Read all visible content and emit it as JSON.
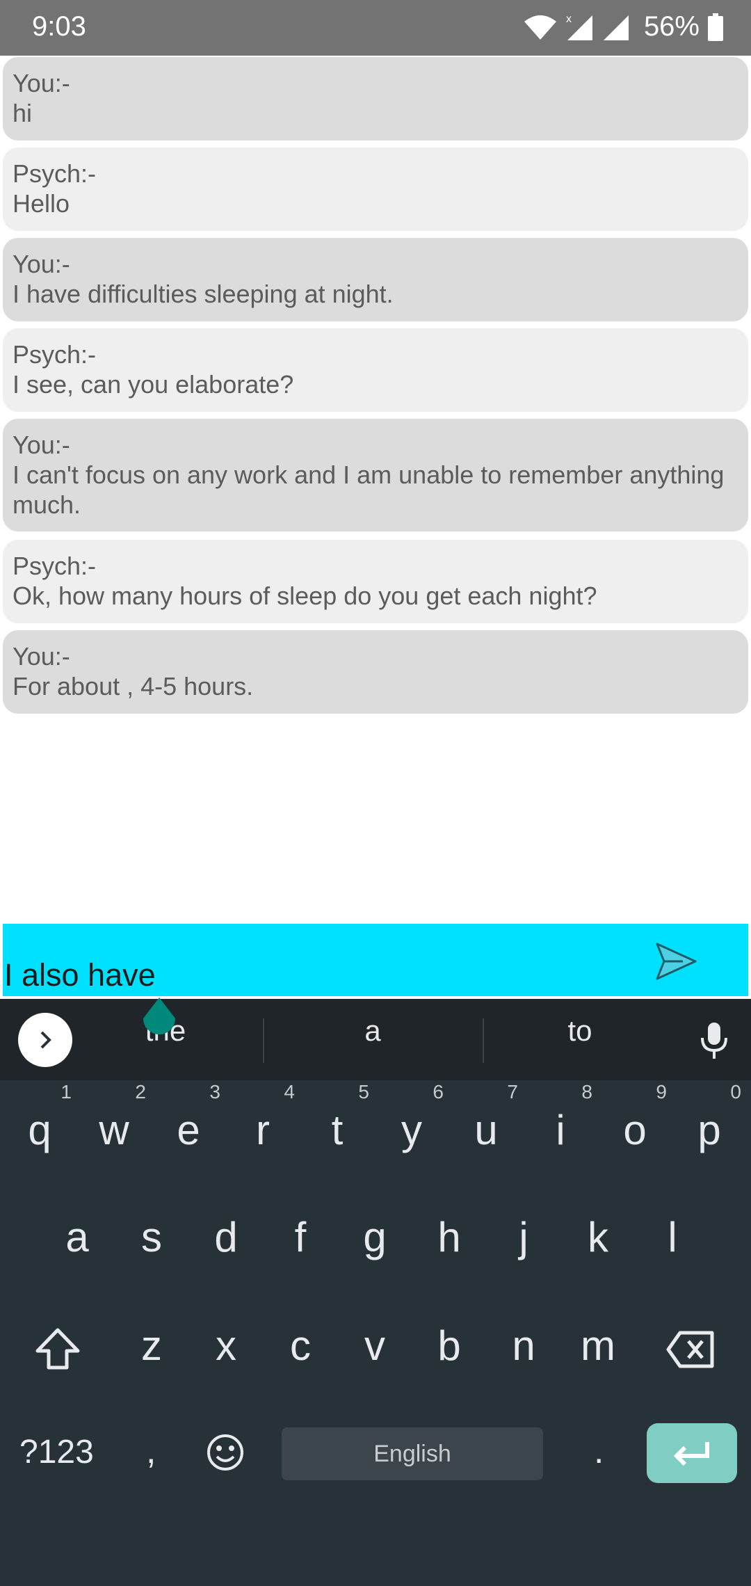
{
  "status_bar": {
    "time": "9:03",
    "battery_percent": "56%",
    "icons": [
      "wifi-icon",
      "signal-x-icon",
      "signal-icon",
      "battery-icon"
    ]
  },
  "messages": [
    {
      "sender": "You:-",
      "text": "hi"
    },
    {
      "sender": "Psych:-",
      "text": "Hello"
    },
    {
      "sender": "You:-",
      "text": "I have difficulties sleeping at night."
    },
    {
      "sender": "Psych:-",
      "text": "I see, can you elaborate?"
    },
    {
      "sender": "You:-",
      "text": "I can't focus on any work and I am unable to remember anything much."
    },
    {
      "sender": "Psych:-",
      "text": "Ok, how many hours of sleep do you get each night?"
    },
    {
      "sender": "You:-",
      "text": "For about , 4-5 hours."
    }
  ],
  "input": {
    "value": "I also have",
    "send_icon": "send-icon"
  },
  "keyboard": {
    "suggestions": [
      "the",
      "a",
      "to"
    ],
    "row1": [
      {
        "key": "q",
        "hint": "1"
      },
      {
        "key": "w",
        "hint": "2"
      },
      {
        "key": "e",
        "hint": "3"
      },
      {
        "key": "r",
        "hint": "4"
      },
      {
        "key": "t",
        "hint": "5"
      },
      {
        "key": "y",
        "hint": "6"
      },
      {
        "key": "u",
        "hint": "7"
      },
      {
        "key": "i",
        "hint": "8"
      },
      {
        "key": "o",
        "hint": "9"
      },
      {
        "key": "p",
        "hint": "0"
      }
    ],
    "row2": [
      "a",
      "s",
      "d",
      "f",
      "g",
      "h",
      "j",
      "k",
      "l"
    ],
    "row3": [
      "z",
      "x",
      "c",
      "v",
      "b",
      "n",
      "m"
    ],
    "symbols_label": "?123",
    "comma_label": ",",
    "period_label": ".",
    "space_label": "English",
    "colors": {
      "background": "#263238",
      "enter": "#7fcdc3",
      "input_bar": "#00e0ff"
    }
  }
}
